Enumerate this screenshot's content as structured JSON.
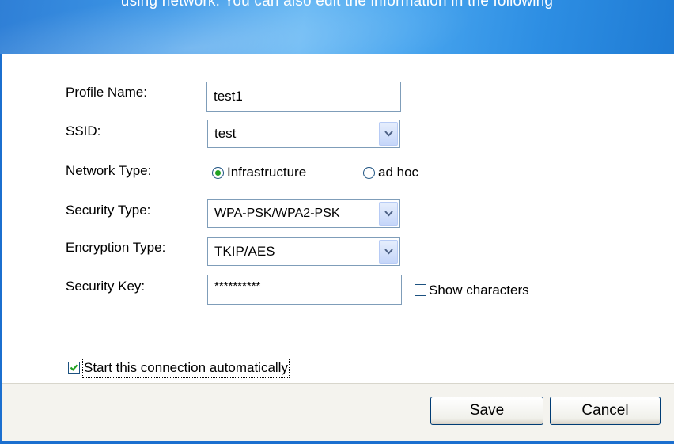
{
  "banner": {
    "caption": "using network. You can also edit the information in the following"
  },
  "form": {
    "profile_name": {
      "label": "Profile Name:",
      "value": "test1"
    },
    "ssid": {
      "label": "SSID:",
      "value": "test"
    },
    "network_type": {
      "label": "Network Type:",
      "options": [
        {
          "label": "Infrastructure",
          "selected": true
        },
        {
          "label": "ad hoc",
          "selected": false
        }
      ]
    },
    "security_type": {
      "label": "Security Type:",
      "value": "WPA-PSK/WPA2-PSK"
    },
    "encryption_type": {
      "label": "Encryption Type:",
      "value": "TKIP/AES"
    },
    "security_key": {
      "label": "Security Key:",
      "value": "**********"
    },
    "show_characters": {
      "label": "Show characters",
      "checked": false
    },
    "auto_connect": {
      "label": "Start this connection automatically",
      "checked": true
    }
  },
  "footer": {
    "save_label": "Save",
    "cancel_label": "Cancel"
  },
  "colors": {
    "banner": "#3d98e8",
    "radio_dot": "#21a121",
    "checkmark": "#21a121",
    "footer_bg": "#f4f3ee"
  }
}
